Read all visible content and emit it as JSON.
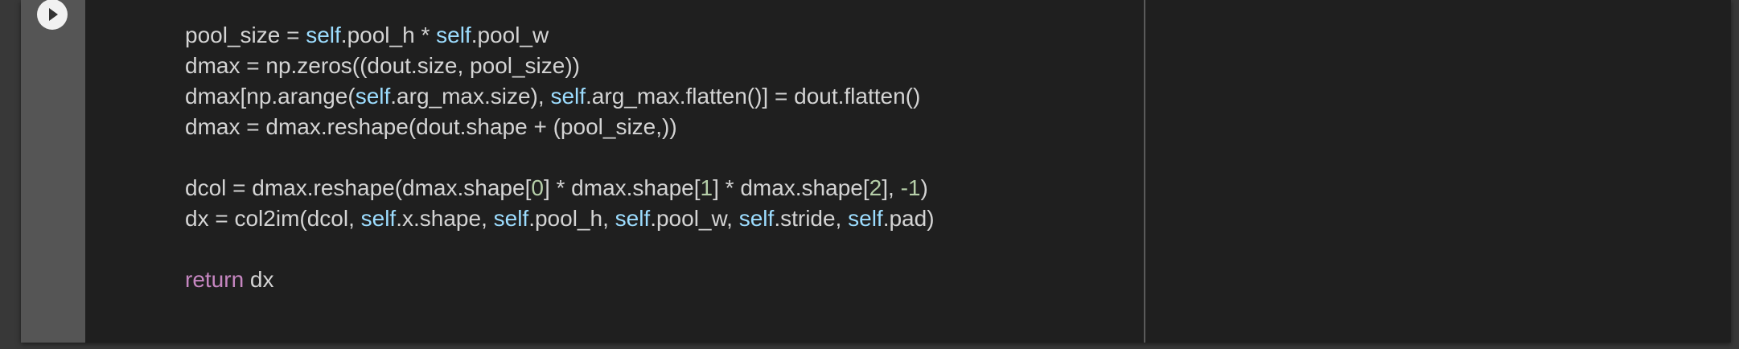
{
  "cell": {
    "run_button": {
      "icon": "play-icon"
    },
    "colors": {
      "text": "#d4d4d4",
      "self": "#9cdcfe",
      "keyword": "#c586c0",
      "number": "#b5cea8",
      "background": "#1f1f1f"
    },
    "lines": [
      [
        [
          "t",
          "pool_size = "
        ],
        [
          "self",
          "self"
        ],
        [
          "t",
          ".pool_h * "
        ],
        [
          "self",
          "self"
        ],
        [
          "t",
          ".pool_w"
        ]
      ],
      [
        [
          "t",
          "dmax = np.zeros((dout.size, pool_size))"
        ]
      ],
      [
        [
          "t",
          "dmax[np.arange("
        ],
        [
          "self",
          "self"
        ],
        [
          "t",
          ".arg_max.size), "
        ],
        [
          "self",
          "self"
        ],
        [
          "t",
          ".arg_max.flatten()] = dout.flatten()"
        ]
      ],
      [
        [
          "t",
          "dmax = dmax.reshape(dout.shape + (pool_size,))"
        ]
      ],
      [],
      [
        [
          "t",
          "dcol = dmax.reshape(dmax.shape["
        ],
        [
          "num",
          "0"
        ],
        [
          "t",
          "] * dmax.shape["
        ],
        [
          "num",
          "1"
        ],
        [
          "t",
          "] * dmax.shape["
        ],
        [
          "num",
          "2"
        ],
        [
          "t",
          "], "
        ],
        [
          "num",
          "-1"
        ],
        [
          "t",
          ")"
        ]
      ],
      [
        [
          "t",
          "dx = col2im(dcol, "
        ],
        [
          "self",
          "self"
        ],
        [
          "t",
          ".x.shape, "
        ],
        [
          "self",
          "self"
        ],
        [
          "t",
          ".pool_h, "
        ],
        [
          "self",
          "self"
        ],
        [
          "t",
          ".pool_w, "
        ],
        [
          "self",
          "self"
        ],
        [
          "t",
          ".stride, "
        ],
        [
          "self",
          "self"
        ],
        [
          "t",
          ".pad)"
        ]
      ],
      [],
      [
        [
          "kw",
          "return"
        ],
        [
          "t",
          " dx"
        ]
      ]
    ]
  }
}
